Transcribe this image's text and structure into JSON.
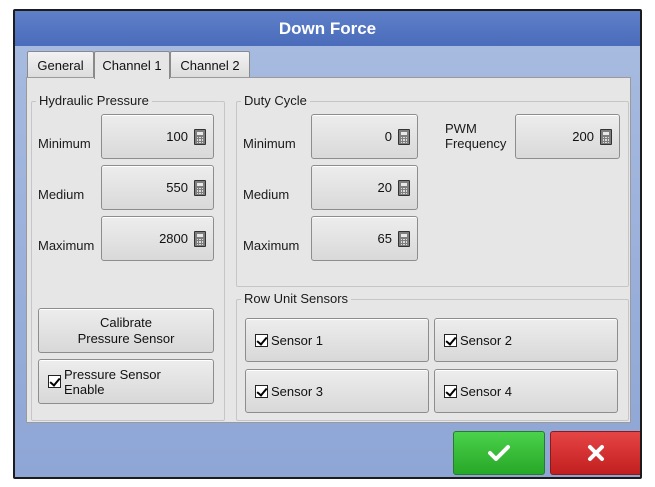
{
  "dialog": {
    "title": "Down Force"
  },
  "tabs": [
    {
      "label": "General",
      "active": false
    },
    {
      "label": "Channel 1",
      "active": true
    },
    {
      "label": "Channel 2",
      "active": false
    }
  ],
  "hydraulic_pressure": {
    "title": "Hydraulic Pressure",
    "minimum": {
      "label": "Minimum",
      "value": "100"
    },
    "medium": {
      "label": "Medium",
      "value": "550"
    },
    "maximum": {
      "label": "Maximum",
      "value": "2800"
    },
    "calibrate_button": {
      "line1": "Calibrate",
      "line2": "Pressure Sensor"
    },
    "pressure_sensor_enable": {
      "line1": "Pressure Sensor",
      "line2": "Enable",
      "checked": true
    }
  },
  "duty_cycle": {
    "title": "Duty Cycle",
    "minimum": {
      "label": "Minimum",
      "value": "0"
    },
    "medium": {
      "label": "Medium",
      "value": "20"
    },
    "maximum": {
      "label": "Maximum",
      "value": "65"
    },
    "pwm_frequency": {
      "line1": "PWM",
      "line2": "Frequency",
      "value": "200"
    }
  },
  "row_unit_sensors": {
    "title": "Row Unit Sensors",
    "sensors": [
      {
        "label": "Sensor 1",
        "checked": true
      },
      {
        "label": "Sensor 2",
        "checked": true
      },
      {
        "label": "Sensor 3",
        "checked": true
      },
      {
        "label": "Sensor 4",
        "checked": true
      }
    ]
  },
  "actions": {
    "ok_icon": "checkmark-icon",
    "cancel_icon": "x-icon",
    "ok_color": "#2fb52f",
    "cancel_color": "#d02a2a"
  }
}
